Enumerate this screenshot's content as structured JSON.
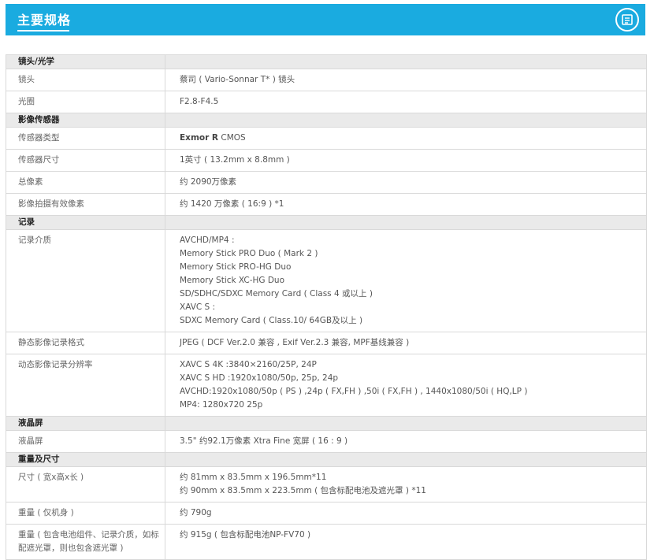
{
  "header": {
    "title": "主要规格"
  },
  "sections": [
    {
      "name": "镜头/光学",
      "rows": [
        {
          "key": "镜头",
          "lines": [
            "蔡司 ( Vario-Sonnar T* ) 镜头"
          ]
        },
        {
          "key": "光圈",
          "lines": [
            "F2.8-F4.5"
          ]
        }
      ]
    },
    {
      "name": "影像传感器",
      "rows": [
        {
          "key": "传感器类型",
          "bold": "Exmor R",
          "rest": " CMOS"
        },
        {
          "key": "传感器尺寸",
          "lines": [
            "1英寸 ( 13.2mm x 8.8mm )"
          ]
        },
        {
          "key": "总像素",
          "lines": [
            "约 2090万像素"
          ]
        },
        {
          "key": "影像拍摄有效像素",
          "lines": [
            "约 1420 万像素 ( 16:9 ) *1"
          ]
        }
      ]
    },
    {
      "name": "记录",
      "rows": [
        {
          "key": "记录介质",
          "lines": [
            "AVCHD/MP4 :",
            "Memory Stick PRO Duo ( Mark 2 )",
            "Memory Stick PRO-HG Duo",
            "Memory Stick XC-HG Duo",
            "SD/SDHC/SDXC Memory Card ( Class 4 或以上 )",
            "XAVC S :",
            "SDXC Memory Card ( Class.10/ 64GB及以上 )"
          ]
        },
        {
          "key": "静态影像记录格式",
          "lines": [
            "JPEG ( DCF Ver.2.0 兼容 , Exif Ver.2.3 兼容, MPF基线兼容 )"
          ]
        },
        {
          "key": "动态影像记录分辨率",
          "lines": [
            "XAVC S 4K :3840×2160/25P, 24P",
            "XAVC S HD :1920x1080/50p, 25p, 24p",
            "AVCHD:1920x1080/50p ( PS ) ,24p ( FX,FH ) ,50i ( FX,FH ) , 1440x1080/50i ( HQ,LP )",
            "MP4: 1280x720 25p"
          ]
        }
      ]
    },
    {
      "name": "液晶屏",
      "rows": [
        {
          "key": "液晶屏",
          "lines": [
            "3.5\" 约92.1万像素 Xtra Fine 宽屏 ( 16 : 9 )"
          ]
        }
      ]
    },
    {
      "name": "重量及尺寸",
      "rows": [
        {
          "key": "尺寸 ( 宽x高x长 )",
          "lines": [
            "约 81mm x 83.5mm x 196.5mm*11",
            "约 90mm x 83.5mm x 223.5mm ( 包含标配电池及遮光罩 ) *11"
          ]
        },
        {
          "key": "重量 ( 仅机身 )",
          "lines": [
            "约 790g"
          ]
        },
        {
          "key": "重量 ( 包含电池组件、记录介质，如标配遮光罩，则也包含遮光罩 )",
          "lines": [
            "约 915g ( 包含标配电池NP-FV70 )"
          ]
        }
      ]
    }
  ]
}
